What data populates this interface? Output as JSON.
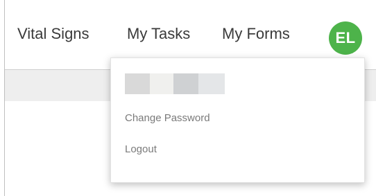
{
  "nav": {
    "links": [
      "Vital Signs",
      "My Tasks",
      "My Forms"
    ]
  },
  "user": {
    "initials": "EL",
    "avatar_color": "#4db34a"
  },
  "dropdown": {
    "name_redacted_blocks": [
      "#d9d9d9",
      "#f0f0ee",
      "#cfd1d3",
      "#e4e6e8"
    ],
    "items": [
      "Change Password",
      "Logout"
    ]
  }
}
